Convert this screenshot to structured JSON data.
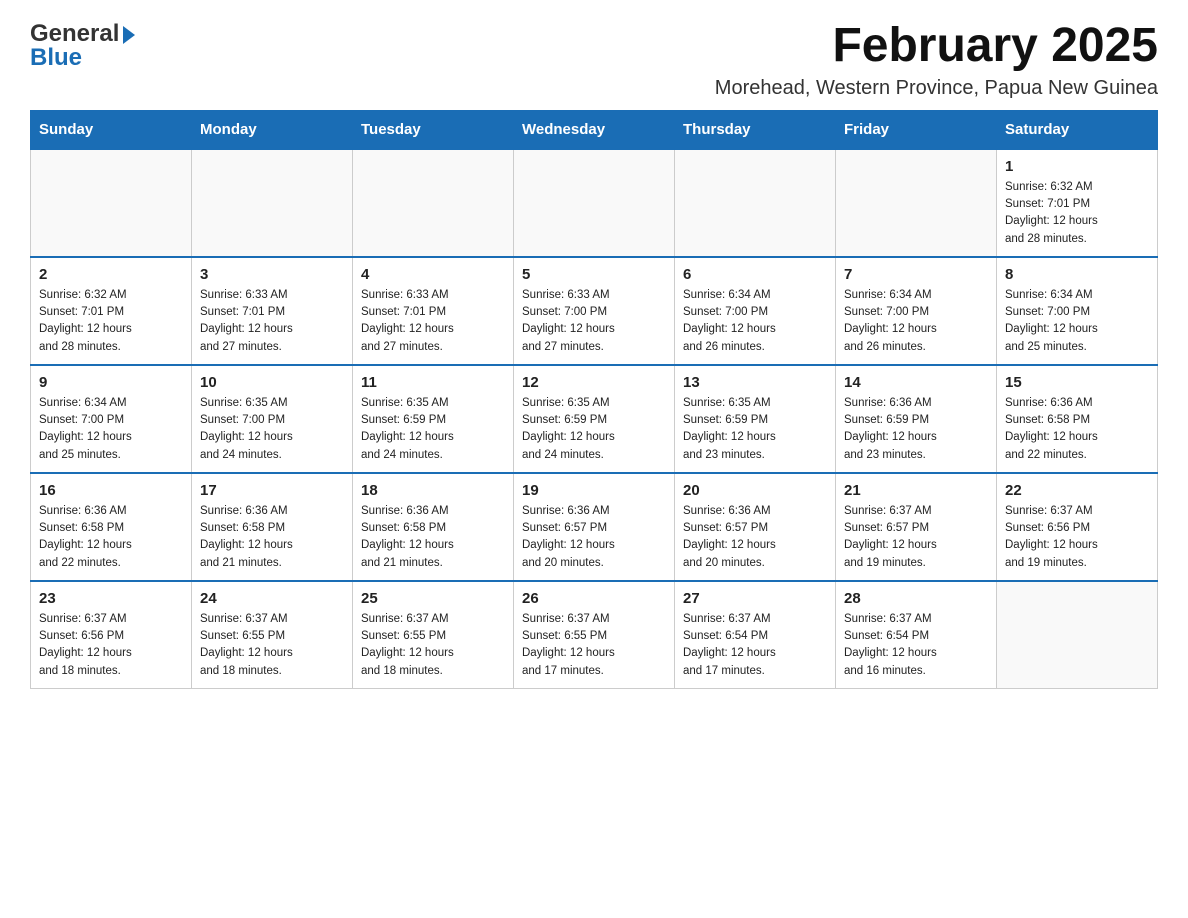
{
  "header": {
    "logo_general": "General",
    "logo_blue": "Blue",
    "month_title": "February 2025",
    "location": "Morehead, Western Province, Papua New Guinea"
  },
  "weekdays": [
    "Sunday",
    "Monday",
    "Tuesday",
    "Wednesday",
    "Thursday",
    "Friday",
    "Saturday"
  ],
  "weeks": [
    {
      "days": [
        {
          "num": "",
          "info": ""
        },
        {
          "num": "",
          "info": ""
        },
        {
          "num": "",
          "info": ""
        },
        {
          "num": "",
          "info": ""
        },
        {
          "num": "",
          "info": ""
        },
        {
          "num": "",
          "info": ""
        },
        {
          "num": "1",
          "info": "Sunrise: 6:32 AM\nSunset: 7:01 PM\nDaylight: 12 hours\nand 28 minutes."
        }
      ]
    },
    {
      "days": [
        {
          "num": "2",
          "info": "Sunrise: 6:32 AM\nSunset: 7:01 PM\nDaylight: 12 hours\nand 28 minutes."
        },
        {
          "num": "3",
          "info": "Sunrise: 6:33 AM\nSunset: 7:01 PM\nDaylight: 12 hours\nand 27 minutes."
        },
        {
          "num": "4",
          "info": "Sunrise: 6:33 AM\nSunset: 7:01 PM\nDaylight: 12 hours\nand 27 minutes."
        },
        {
          "num": "5",
          "info": "Sunrise: 6:33 AM\nSunset: 7:00 PM\nDaylight: 12 hours\nand 27 minutes."
        },
        {
          "num": "6",
          "info": "Sunrise: 6:34 AM\nSunset: 7:00 PM\nDaylight: 12 hours\nand 26 minutes."
        },
        {
          "num": "7",
          "info": "Sunrise: 6:34 AM\nSunset: 7:00 PM\nDaylight: 12 hours\nand 26 minutes."
        },
        {
          "num": "8",
          "info": "Sunrise: 6:34 AM\nSunset: 7:00 PM\nDaylight: 12 hours\nand 25 minutes."
        }
      ]
    },
    {
      "days": [
        {
          "num": "9",
          "info": "Sunrise: 6:34 AM\nSunset: 7:00 PM\nDaylight: 12 hours\nand 25 minutes."
        },
        {
          "num": "10",
          "info": "Sunrise: 6:35 AM\nSunset: 7:00 PM\nDaylight: 12 hours\nand 24 minutes."
        },
        {
          "num": "11",
          "info": "Sunrise: 6:35 AM\nSunset: 6:59 PM\nDaylight: 12 hours\nand 24 minutes."
        },
        {
          "num": "12",
          "info": "Sunrise: 6:35 AM\nSunset: 6:59 PM\nDaylight: 12 hours\nand 24 minutes."
        },
        {
          "num": "13",
          "info": "Sunrise: 6:35 AM\nSunset: 6:59 PM\nDaylight: 12 hours\nand 23 minutes."
        },
        {
          "num": "14",
          "info": "Sunrise: 6:36 AM\nSunset: 6:59 PM\nDaylight: 12 hours\nand 23 minutes."
        },
        {
          "num": "15",
          "info": "Sunrise: 6:36 AM\nSunset: 6:58 PM\nDaylight: 12 hours\nand 22 minutes."
        }
      ]
    },
    {
      "days": [
        {
          "num": "16",
          "info": "Sunrise: 6:36 AM\nSunset: 6:58 PM\nDaylight: 12 hours\nand 22 minutes."
        },
        {
          "num": "17",
          "info": "Sunrise: 6:36 AM\nSunset: 6:58 PM\nDaylight: 12 hours\nand 21 minutes."
        },
        {
          "num": "18",
          "info": "Sunrise: 6:36 AM\nSunset: 6:58 PM\nDaylight: 12 hours\nand 21 minutes."
        },
        {
          "num": "19",
          "info": "Sunrise: 6:36 AM\nSunset: 6:57 PM\nDaylight: 12 hours\nand 20 minutes."
        },
        {
          "num": "20",
          "info": "Sunrise: 6:36 AM\nSunset: 6:57 PM\nDaylight: 12 hours\nand 20 minutes."
        },
        {
          "num": "21",
          "info": "Sunrise: 6:37 AM\nSunset: 6:57 PM\nDaylight: 12 hours\nand 19 minutes."
        },
        {
          "num": "22",
          "info": "Sunrise: 6:37 AM\nSunset: 6:56 PM\nDaylight: 12 hours\nand 19 minutes."
        }
      ]
    },
    {
      "days": [
        {
          "num": "23",
          "info": "Sunrise: 6:37 AM\nSunset: 6:56 PM\nDaylight: 12 hours\nand 18 minutes."
        },
        {
          "num": "24",
          "info": "Sunrise: 6:37 AM\nSunset: 6:55 PM\nDaylight: 12 hours\nand 18 minutes."
        },
        {
          "num": "25",
          "info": "Sunrise: 6:37 AM\nSunset: 6:55 PM\nDaylight: 12 hours\nand 18 minutes."
        },
        {
          "num": "26",
          "info": "Sunrise: 6:37 AM\nSunset: 6:55 PM\nDaylight: 12 hours\nand 17 minutes."
        },
        {
          "num": "27",
          "info": "Sunrise: 6:37 AM\nSunset: 6:54 PM\nDaylight: 12 hours\nand 17 minutes."
        },
        {
          "num": "28",
          "info": "Sunrise: 6:37 AM\nSunset: 6:54 PM\nDaylight: 12 hours\nand 16 minutes."
        },
        {
          "num": "",
          "info": ""
        }
      ]
    }
  ]
}
